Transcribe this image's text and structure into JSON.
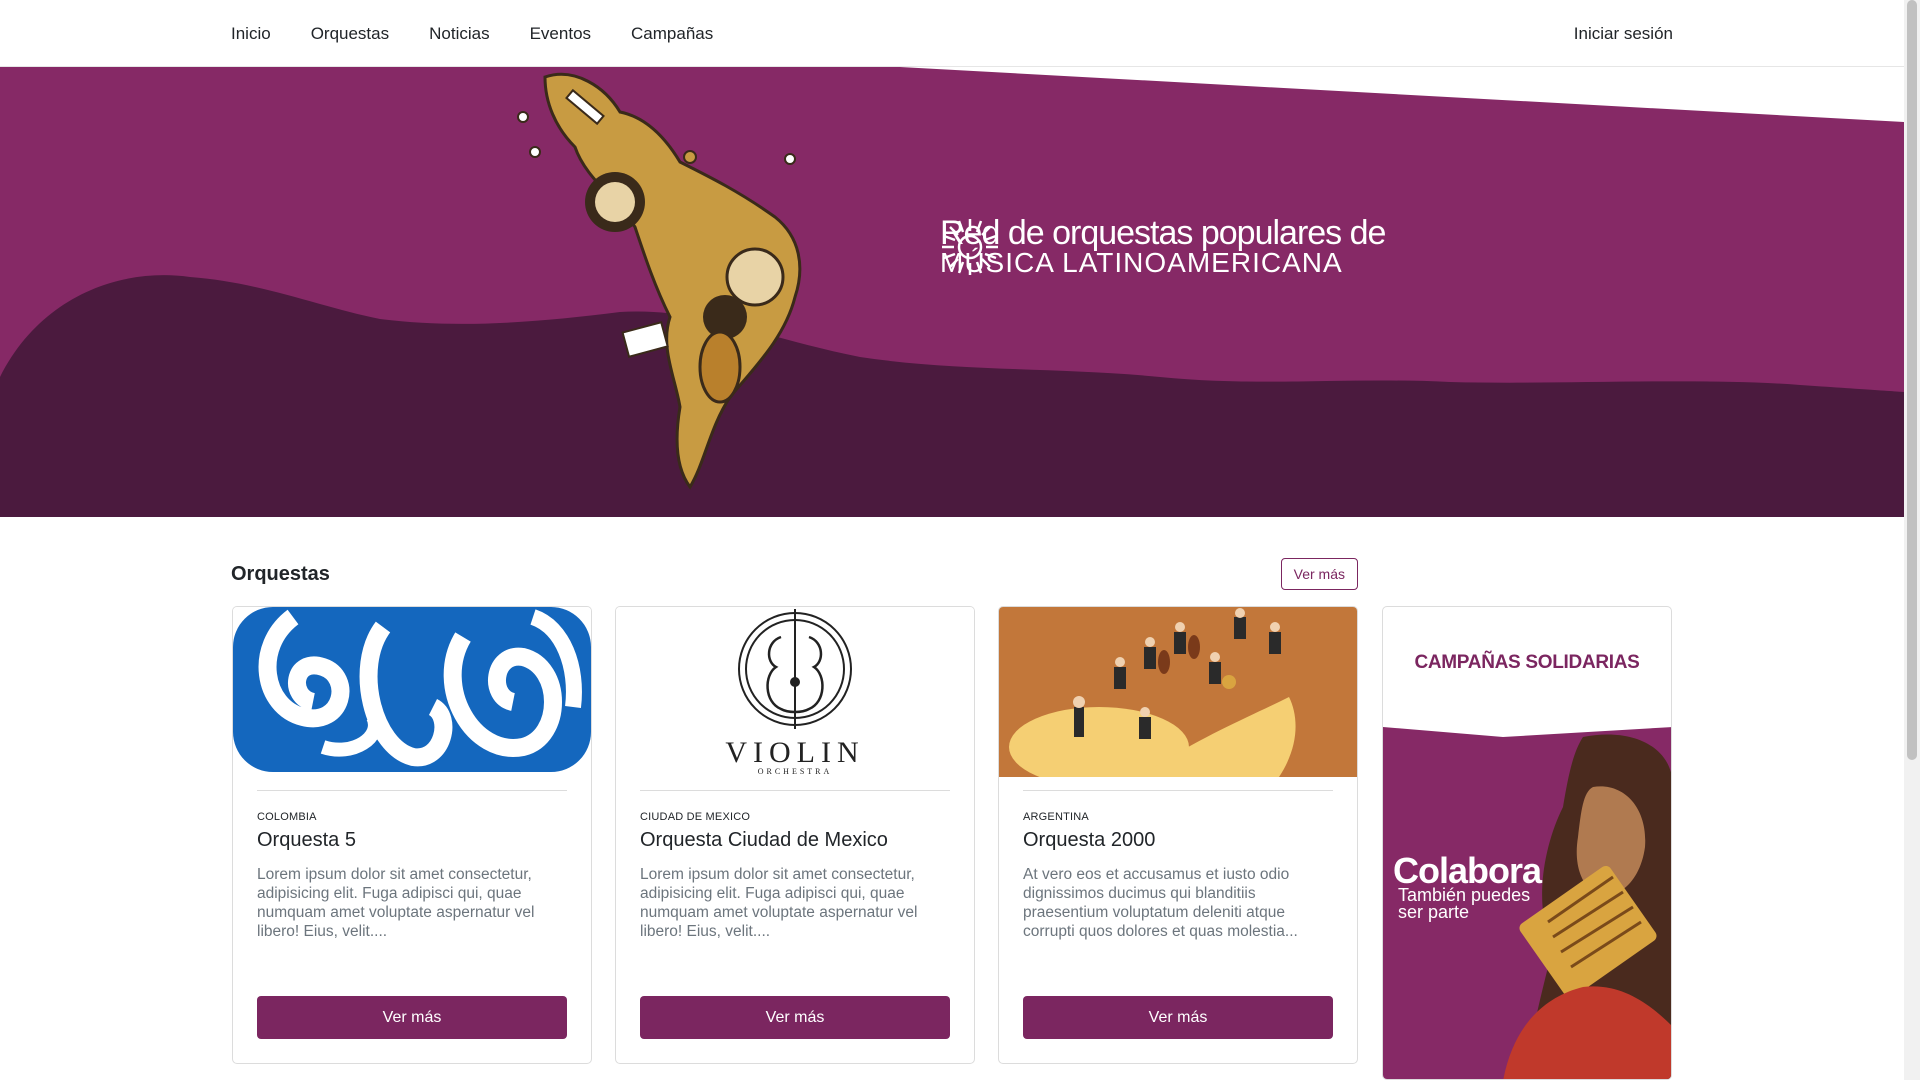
{
  "nav": {
    "links": [
      "Inicio",
      "Orquestas",
      "Noticias",
      "Eventos",
      "Campañas"
    ],
    "login": "Iniciar sesión"
  },
  "hero": {
    "title_line1": "Red de orquestas populares de",
    "title_line2": "MÚSICA LATINOAMERICANA",
    "colors": {
      "purple": "#862966",
      "dark_purple": "#4b1a3e",
      "gold": "#c89b42"
    }
  },
  "section": {
    "title": "Orquestas",
    "more_label": "Ver más"
  },
  "cards": [
    {
      "country": "COLOMBIA",
      "title": "Orquesta 5",
      "text": "Lorem ipsum dolor sit amet consectetur, adipisicing elit. Fuga adipisci qui, quae numquam amet voluptate aspernatur vel libero! Eius, velit....",
      "button": "Ver más"
    },
    {
      "country": "CIUDAD DE MEXICO",
      "title": "Orquesta Ciudad de Mexico",
      "text": "Lorem ipsum dolor sit amet consectetur, adipisicing elit. Fuga adipisci qui, quae numquam amet voluptate aspernatur vel libero! Eius, velit....",
      "button": "Ver más",
      "image_text": "VIOLIN",
      "image_subtext": "ORCHESTRA"
    },
    {
      "country": "ARGENTINA",
      "title": "Orquesta 2000",
      "text": "At vero eos et accusamus et iusto odio dignissimos ducimus qui blanditiis praesentium voluptatum deleniti atque corrupti quos dolores et quas molestia...",
      "button": "Ver más"
    }
  ],
  "campaign": {
    "title": "CAMPAÑAS SOLIDARIAS",
    "headline": "Colabora",
    "subline": "También puedes ser parte"
  },
  "brand_color": "#7b2660"
}
